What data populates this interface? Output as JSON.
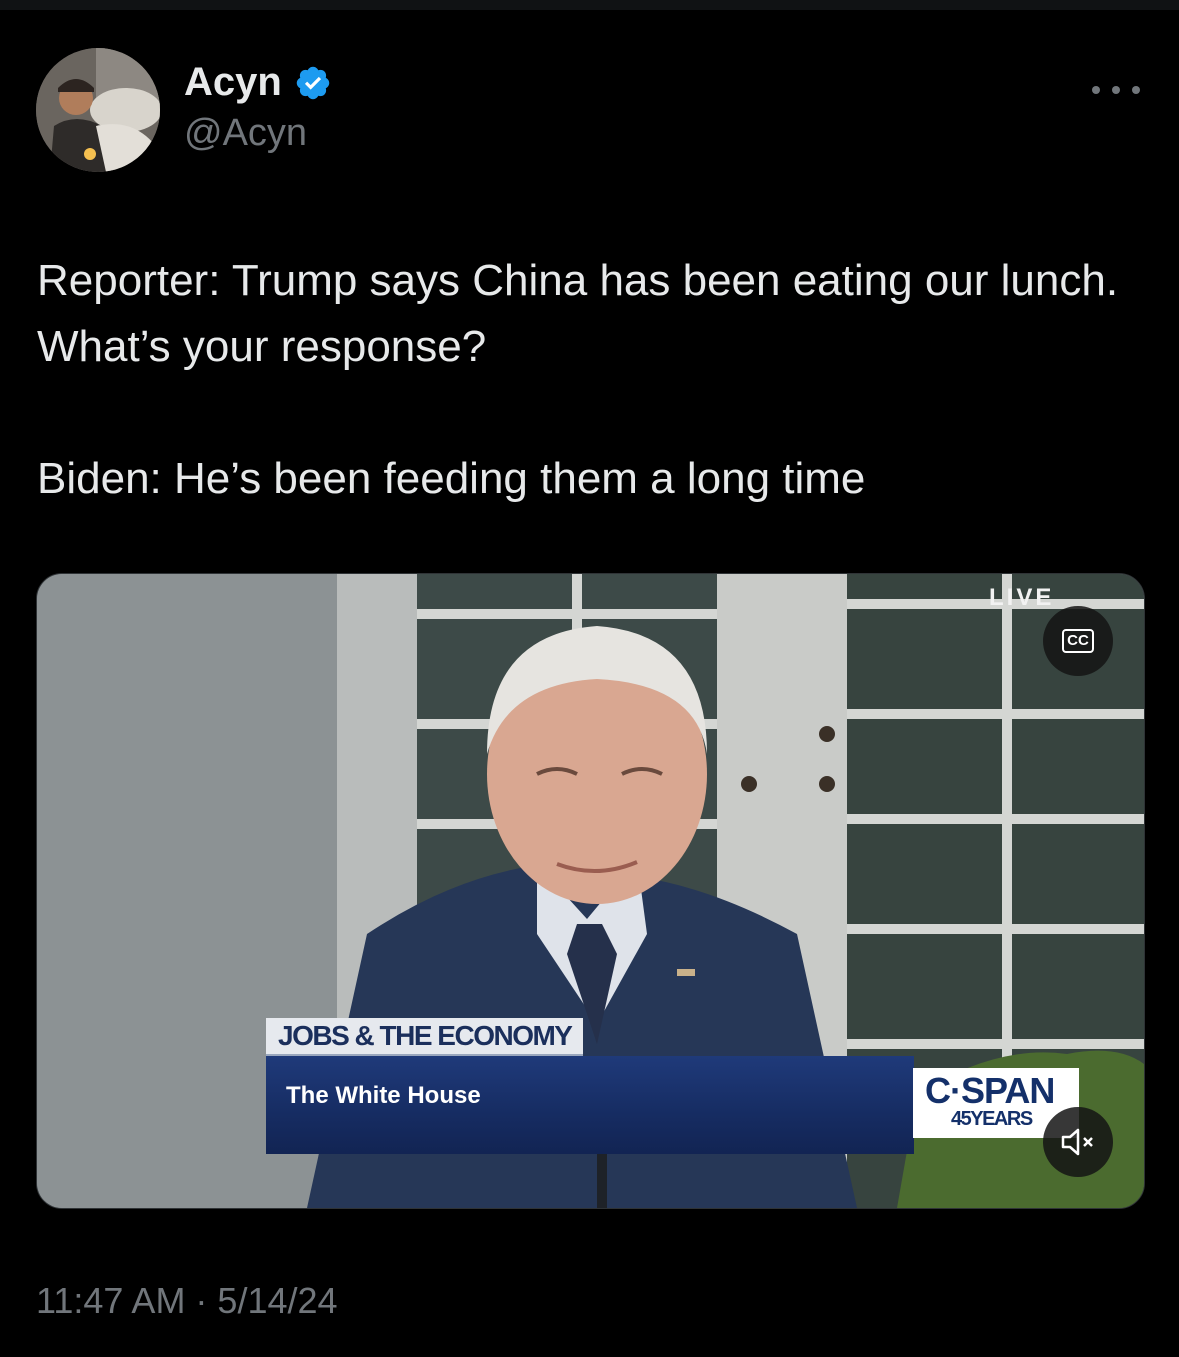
{
  "tweet": {
    "display_name": "Acyn",
    "handle": "@Acyn",
    "verified_icon": "verified-badge-icon",
    "text": "Reporter: Trump says China has been eating our lunch. What’s your response?\n\nBiden: He’s been feeding them a long time",
    "timestamp": "11:47 AM · 5/14/24"
  },
  "video": {
    "live_label": "LIVE",
    "cc_label": "CC",
    "chyron_topic": "JOBS & THE ECONOMY",
    "chyron_title": "The White House",
    "network_logo": "C·SPAN",
    "network_sub": "45YEARS",
    "mute_icon": "speaker-muted-icon"
  },
  "colors": {
    "background": "#000000",
    "text_primary": "#e7e9ea",
    "text_secondary": "#71767b",
    "verified_blue": "#1d9bf0",
    "chyron_blue": "#1f3a7a"
  }
}
